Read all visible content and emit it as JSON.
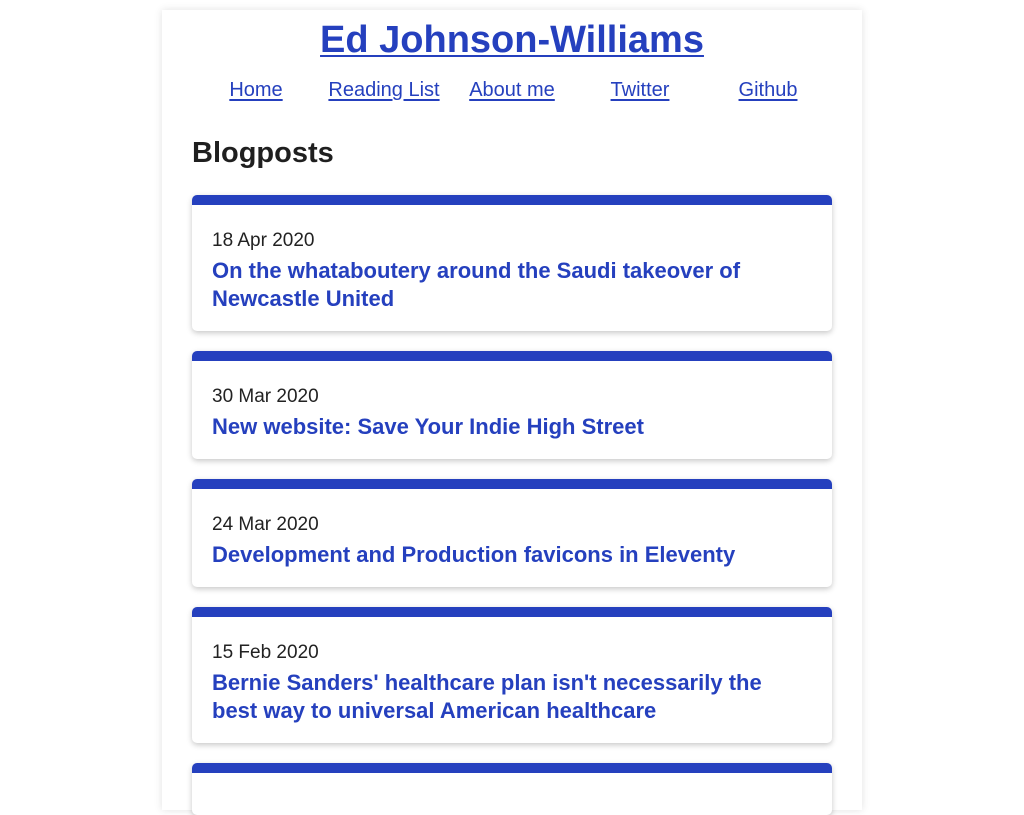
{
  "site": {
    "title": "Ed Johnson-Williams"
  },
  "nav": {
    "items": [
      {
        "label": "Home"
      },
      {
        "label": "Reading List"
      },
      {
        "label": "About me"
      },
      {
        "label": "Twitter"
      },
      {
        "label": "Github"
      }
    ]
  },
  "main": {
    "heading": "Blogposts",
    "posts": [
      {
        "date": "18 Apr 2020",
        "title": "On the whataboutery around the Saudi takeover of Newcastle United"
      },
      {
        "date": "30 Mar 2020",
        "title": "New website: Save Your Indie High Street"
      },
      {
        "date": "24 Mar 2020",
        "title": "Development and Production favicons in Eleventy"
      },
      {
        "date": "15 Feb 2020",
        "title": "Bernie Sanders' healthcare plan isn't necessarily the best way to universal American healthcare"
      }
    ]
  },
  "colors": {
    "accent": "#2540be",
    "text": "#1a1a1a",
    "background": "#ffffff"
  }
}
